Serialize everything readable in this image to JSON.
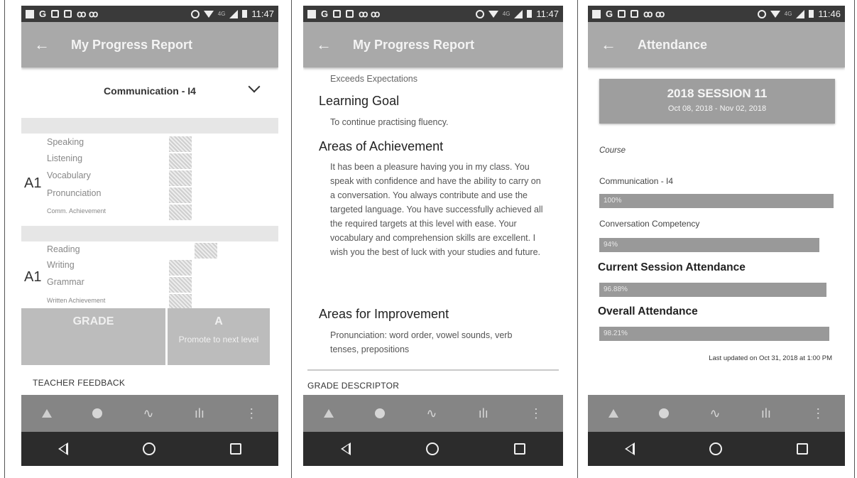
{
  "status_bar": {
    "p1_time": "11:47",
    "p2_time": "11:47",
    "p3_time": "11:46",
    "letters": [
      "G"
    ],
    "network": "4G"
  },
  "panel1": {
    "title": "My Progress Report",
    "dropdown_label": "Communication - I4",
    "group1": {
      "level": "A1",
      "skills": [
        "Speaking",
        "Listening",
        "Vocabulary",
        "Pronunciation",
        "Comm. Achievement"
      ]
    },
    "group2": {
      "level": "A1",
      "skills": [
        "Reading",
        "Writing",
        "Grammar",
        "Written Achievement"
      ]
    },
    "grade_label": "GRADE",
    "grade_value": "A",
    "grade_note": "Promote to next level",
    "teacher_feedback": "TEACHER FEEDBACK"
  },
  "panel2": {
    "title": "My Progress Report",
    "top_text": "Exceeds Expectations",
    "learning_goal_heading": "Learning Goal",
    "learning_goal_text": "To continue practising fluency.",
    "achievement_heading": "Areas of Achievement",
    "achievement_text": "It has been a pleasure having you in my class. You speak with confidence and have the ability to carry on a conversation. You always contribute and use the targeted language. You have successfully achieved all the required targets at this level with ease. Your vocabulary and comprehension skills are excellent. I wish you the best of luck with your studies and future.",
    "improvement_heading": "Areas for Improvement",
    "improvement_text": "Pronunciation: word order, vowel sounds, verb tenses, prepositions",
    "grade_descriptor": "GRADE DESCRIPTOR"
  },
  "panel3": {
    "title": "Attendance",
    "session_title": "2018 SESSION 11",
    "session_dates": "Oct 08, 2018 - Nov 02, 2018",
    "course_label": "Course",
    "course1_name": "Communication - I4",
    "course1_pct": "100%",
    "course1_value": 1.0,
    "course2_name": "Conversation Competency",
    "course2_pct": "94%",
    "course2_value": 0.94,
    "current_heading": "Current Session Attendance",
    "current_pct": "96.88%",
    "current_value": 0.9688,
    "overall_heading": "Overall Attendance",
    "overall_pct": "98.21%",
    "overall_value": 0.9821,
    "updated": "Last updated on Oct 31, 2018 at 1:00 PM"
  },
  "icons": {
    "back": "←",
    "nav_pulse": "∿",
    "nav_stats": "ılı",
    "nav_more": "⋮"
  }
}
